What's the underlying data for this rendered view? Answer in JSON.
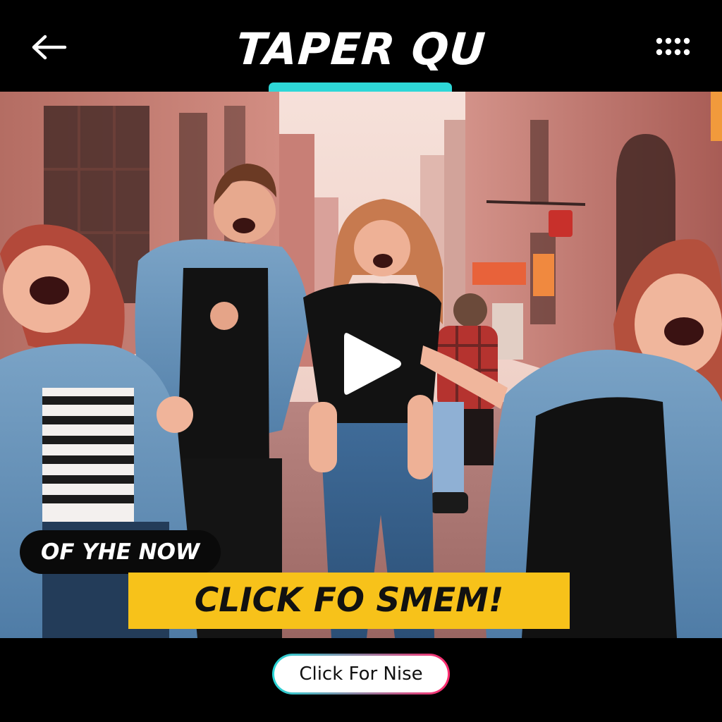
{
  "header": {
    "title": "TAPER QU",
    "back_icon": "arrow-left-icon",
    "menu_icon": "dots-grid-icon",
    "accent_color": "#2ed7d7"
  },
  "video": {
    "play_icon": "play-icon",
    "caption_pill": "OF YHE NOW",
    "cta_banner": "CLICK FO SMEM!",
    "banner_color": "#f7c21a"
  },
  "footer": {
    "cta_button": "Click For Nise",
    "gradient_start": "#25d6d6",
    "gradient_end": "#ff2a6d"
  }
}
